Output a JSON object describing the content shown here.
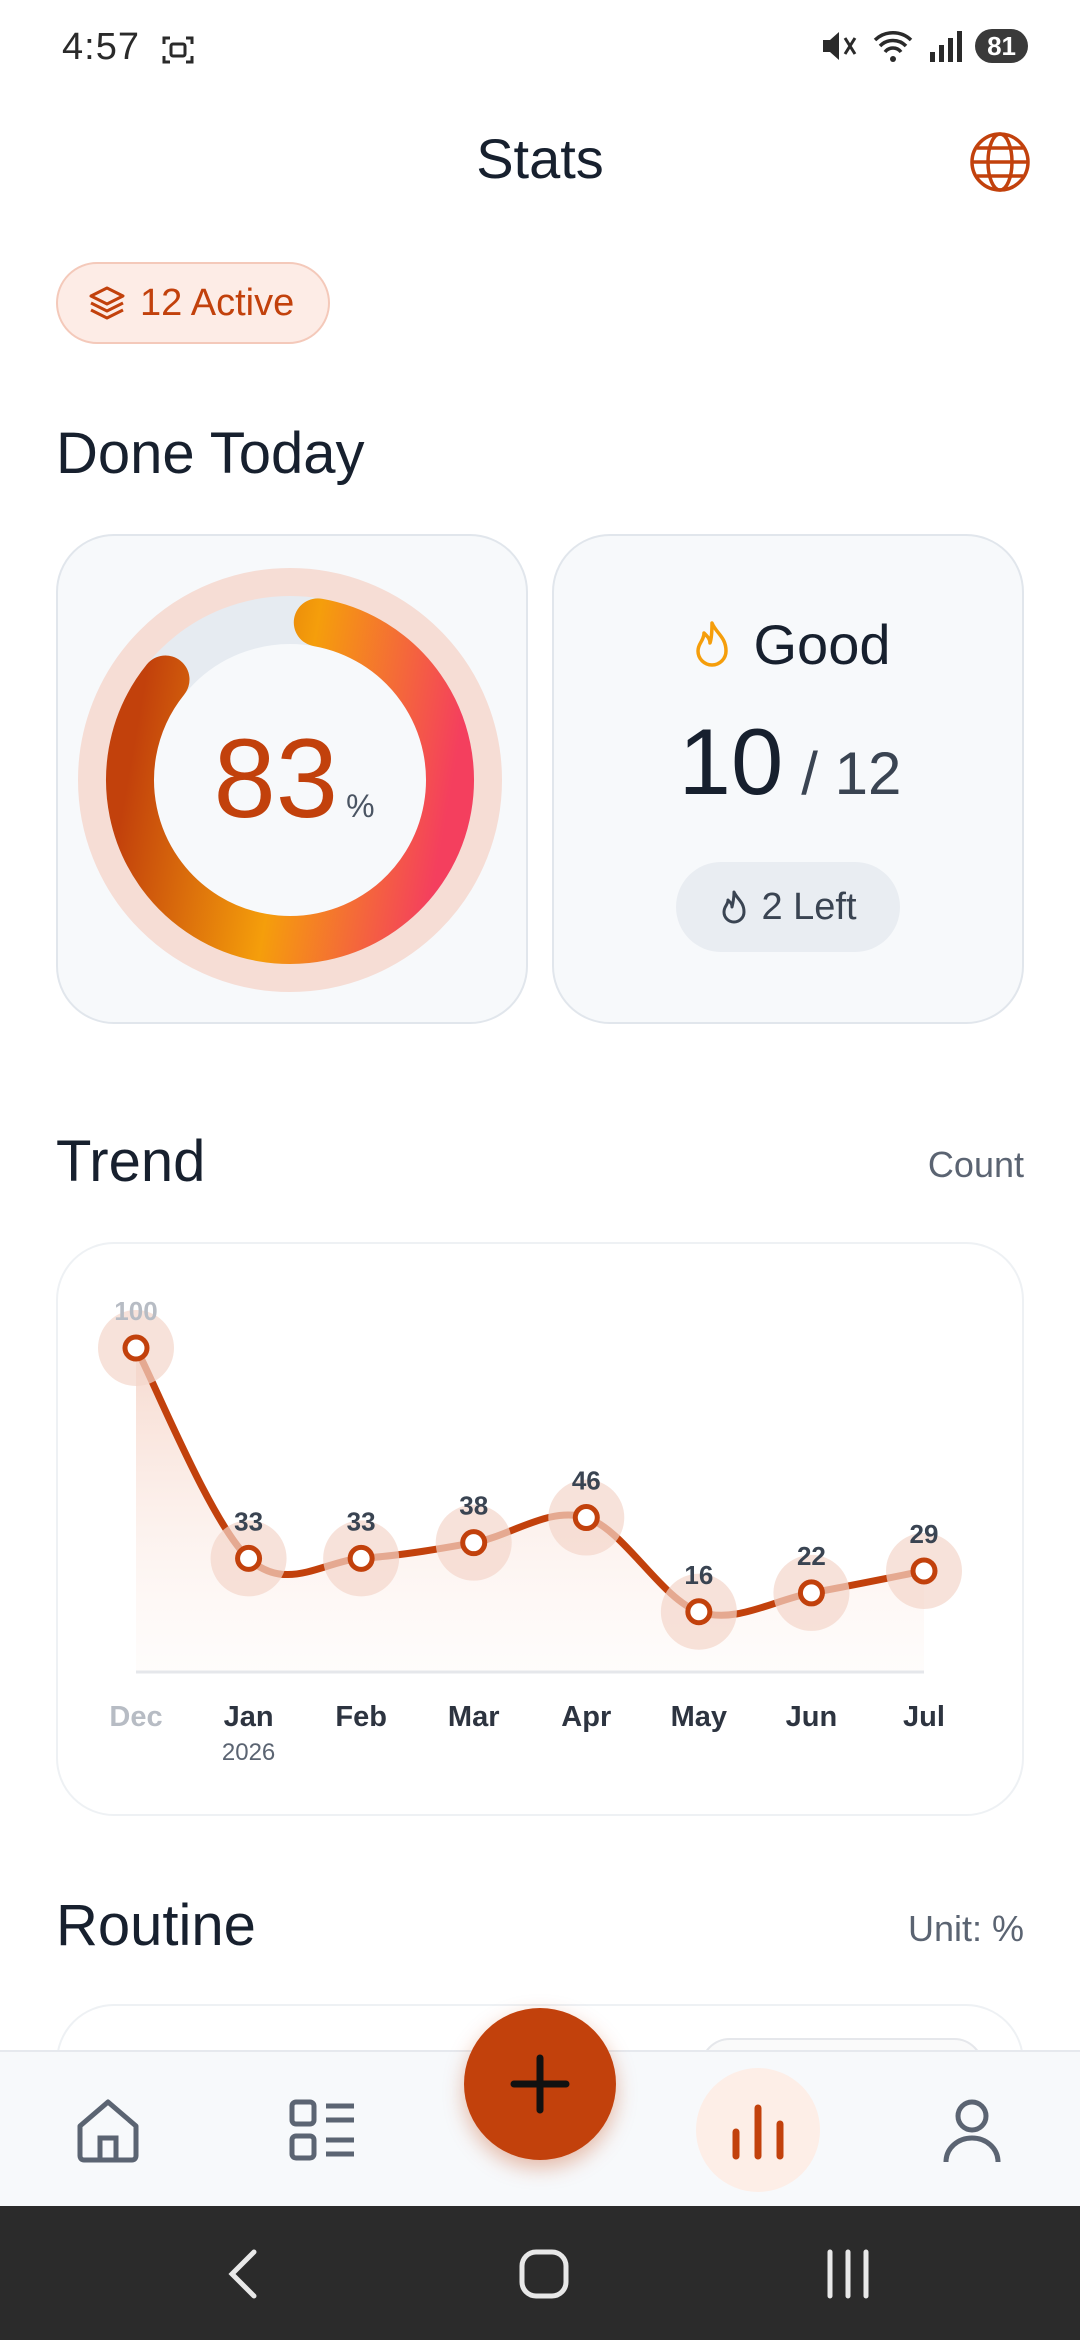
{
  "status_bar": {
    "time": "4:57",
    "battery": "81",
    "icons": [
      "screenshot-icon",
      "mute-icon",
      "wifi-icon",
      "signal-icon",
      "battery-icon"
    ]
  },
  "header": {
    "title": "Stats",
    "globe_icon": "globe-icon"
  },
  "active_chip": {
    "label": "12 Active",
    "icon": "layers-icon"
  },
  "done_today": {
    "title": "Done Today",
    "percent": "83",
    "percent_unit": "%",
    "status": "Good",
    "done": "10",
    "total": "/ 12",
    "left": "2 Left"
  },
  "trend": {
    "title": "Trend",
    "mode": "Count"
  },
  "chart_data": {
    "type": "line",
    "categories": [
      "Dec",
      "Jan",
      "Feb",
      "Mar",
      "Apr",
      "May",
      "Jun",
      "Jul"
    ],
    "sub_labels": [
      "",
      "2026",
      "",
      "",
      "",
      "",
      "",
      ""
    ],
    "values": [
      100,
      33,
      33,
      38,
      46,
      16,
      22,
      29
    ],
    "ylim": [
      0,
      100
    ],
    "colors": {
      "line": "#c2410c",
      "halo": "#f3d5ca"
    },
    "grid": false
  },
  "routine": {
    "title": "Routine",
    "unit": "Unit: %"
  },
  "bottom_nav": {
    "items": [
      {
        "name": "home",
        "icon": "home-icon"
      },
      {
        "name": "list",
        "icon": "list-icon"
      },
      {
        "name": "add",
        "icon": "plus-icon"
      },
      {
        "name": "stats",
        "icon": "bar-chart-icon"
      },
      {
        "name": "profile",
        "icon": "person-icon"
      }
    ]
  },
  "colors": {
    "accent": "#c2410c",
    "text": "#17202e",
    "muted": "#5b6472"
  }
}
